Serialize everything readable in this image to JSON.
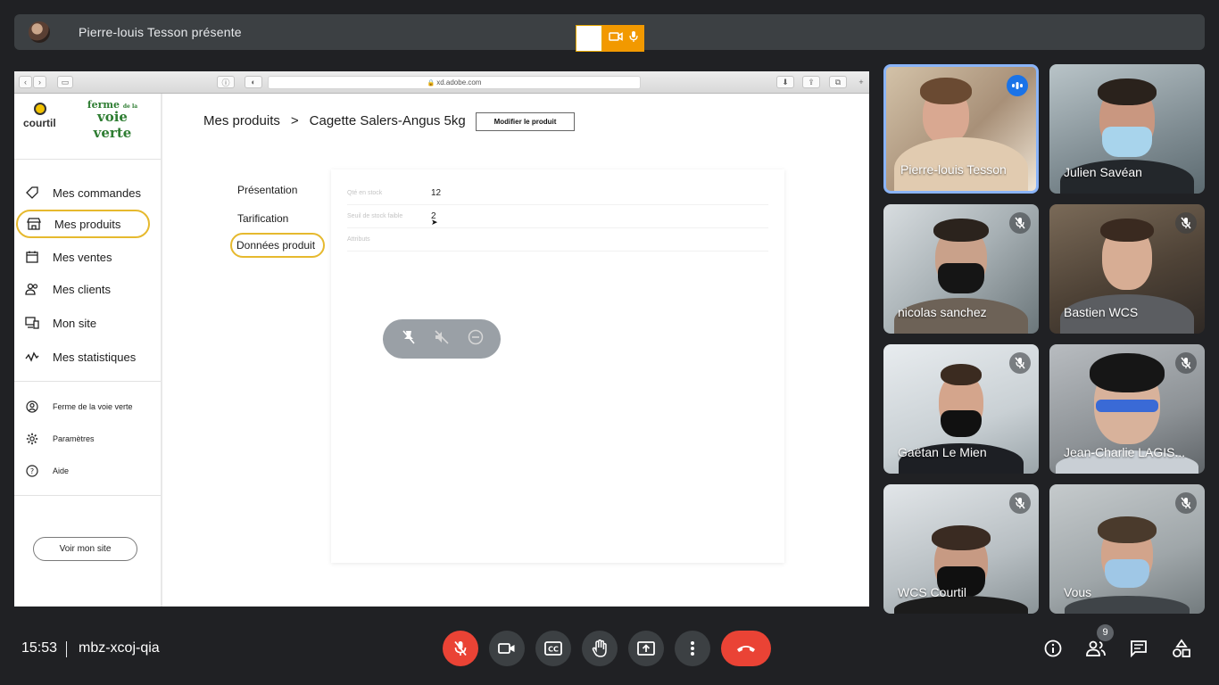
{
  "presenter": {
    "text": "Pierre-louis Tesson présente"
  },
  "browser": {
    "url": "xd.adobe.com"
  },
  "app": {
    "logo_courtil": "courtil",
    "logo_ferme_top": "ferme",
    "logo_ferme_small": "de la",
    "logo_ferme_bottom": "voie verte",
    "nav": [
      {
        "label": "Mes commandes",
        "icon": "tag-icon"
      },
      {
        "label": "Mes produits",
        "icon": "store-icon"
      },
      {
        "label": "Mes ventes",
        "icon": "calendar-icon"
      },
      {
        "label": "Mes clients",
        "icon": "users-icon"
      },
      {
        "label": "Mon site",
        "icon": "devices-icon"
      },
      {
        "label": "Mes statistiques",
        "icon": "chart-line-icon"
      }
    ],
    "secondary_nav": [
      {
        "label": "Ferme de la voie verte",
        "icon": "account-circle-icon"
      },
      {
        "label": "Paramètres",
        "icon": "gear-icon"
      },
      {
        "label": "Aide",
        "icon": "help-icon"
      }
    ],
    "view_site_button": "Voir mon site",
    "breadcrumb": {
      "root": "Mes produits",
      "separator": ">",
      "current": "Cagette Salers-Angus 5kg"
    },
    "modify_button": "Modifier le produit",
    "tabs": [
      "Présentation",
      "Tarification",
      "Données produit"
    ],
    "active_tab": "Données produit",
    "fields": [
      {
        "label": "Qté en stock",
        "value": "12"
      },
      {
        "label": "Seuil de stock faible",
        "value": "2"
      },
      {
        "label": "Attributs",
        "value": ""
      }
    ]
  },
  "participants": [
    {
      "name": "Pierre-louis Tesson",
      "muted": false,
      "speaking": true
    },
    {
      "name": "Julien Savéan",
      "muted": false,
      "speaking": false
    },
    {
      "name": "nicolas sanchez",
      "muted": true
    },
    {
      "name": "Bastien WCS",
      "muted": true
    },
    {
      "name": "Gaëtan Le Mien",
      "muted": true
    },
    {
      "name": "Jean-Charlie LAGIS...",
      "muted": true
    },
    {
      "name": "WCS Courtil",
      "muted": true
    },
    {
      "name": "Vous",
      "muted": true
    }
  ],
  "bottom_bar": {
    "time": "15:53",
    "meeting_code": "mbz-xcoj-qia",
    "participant_count": "9"
  },
  "colors": {
    "meet_background": "#202124",
    "accent_yellow": "#e6b92e",
    "hangup_red": "#ea4335",
    "active_speaker_border": "#8ab4f8"
  }
}
